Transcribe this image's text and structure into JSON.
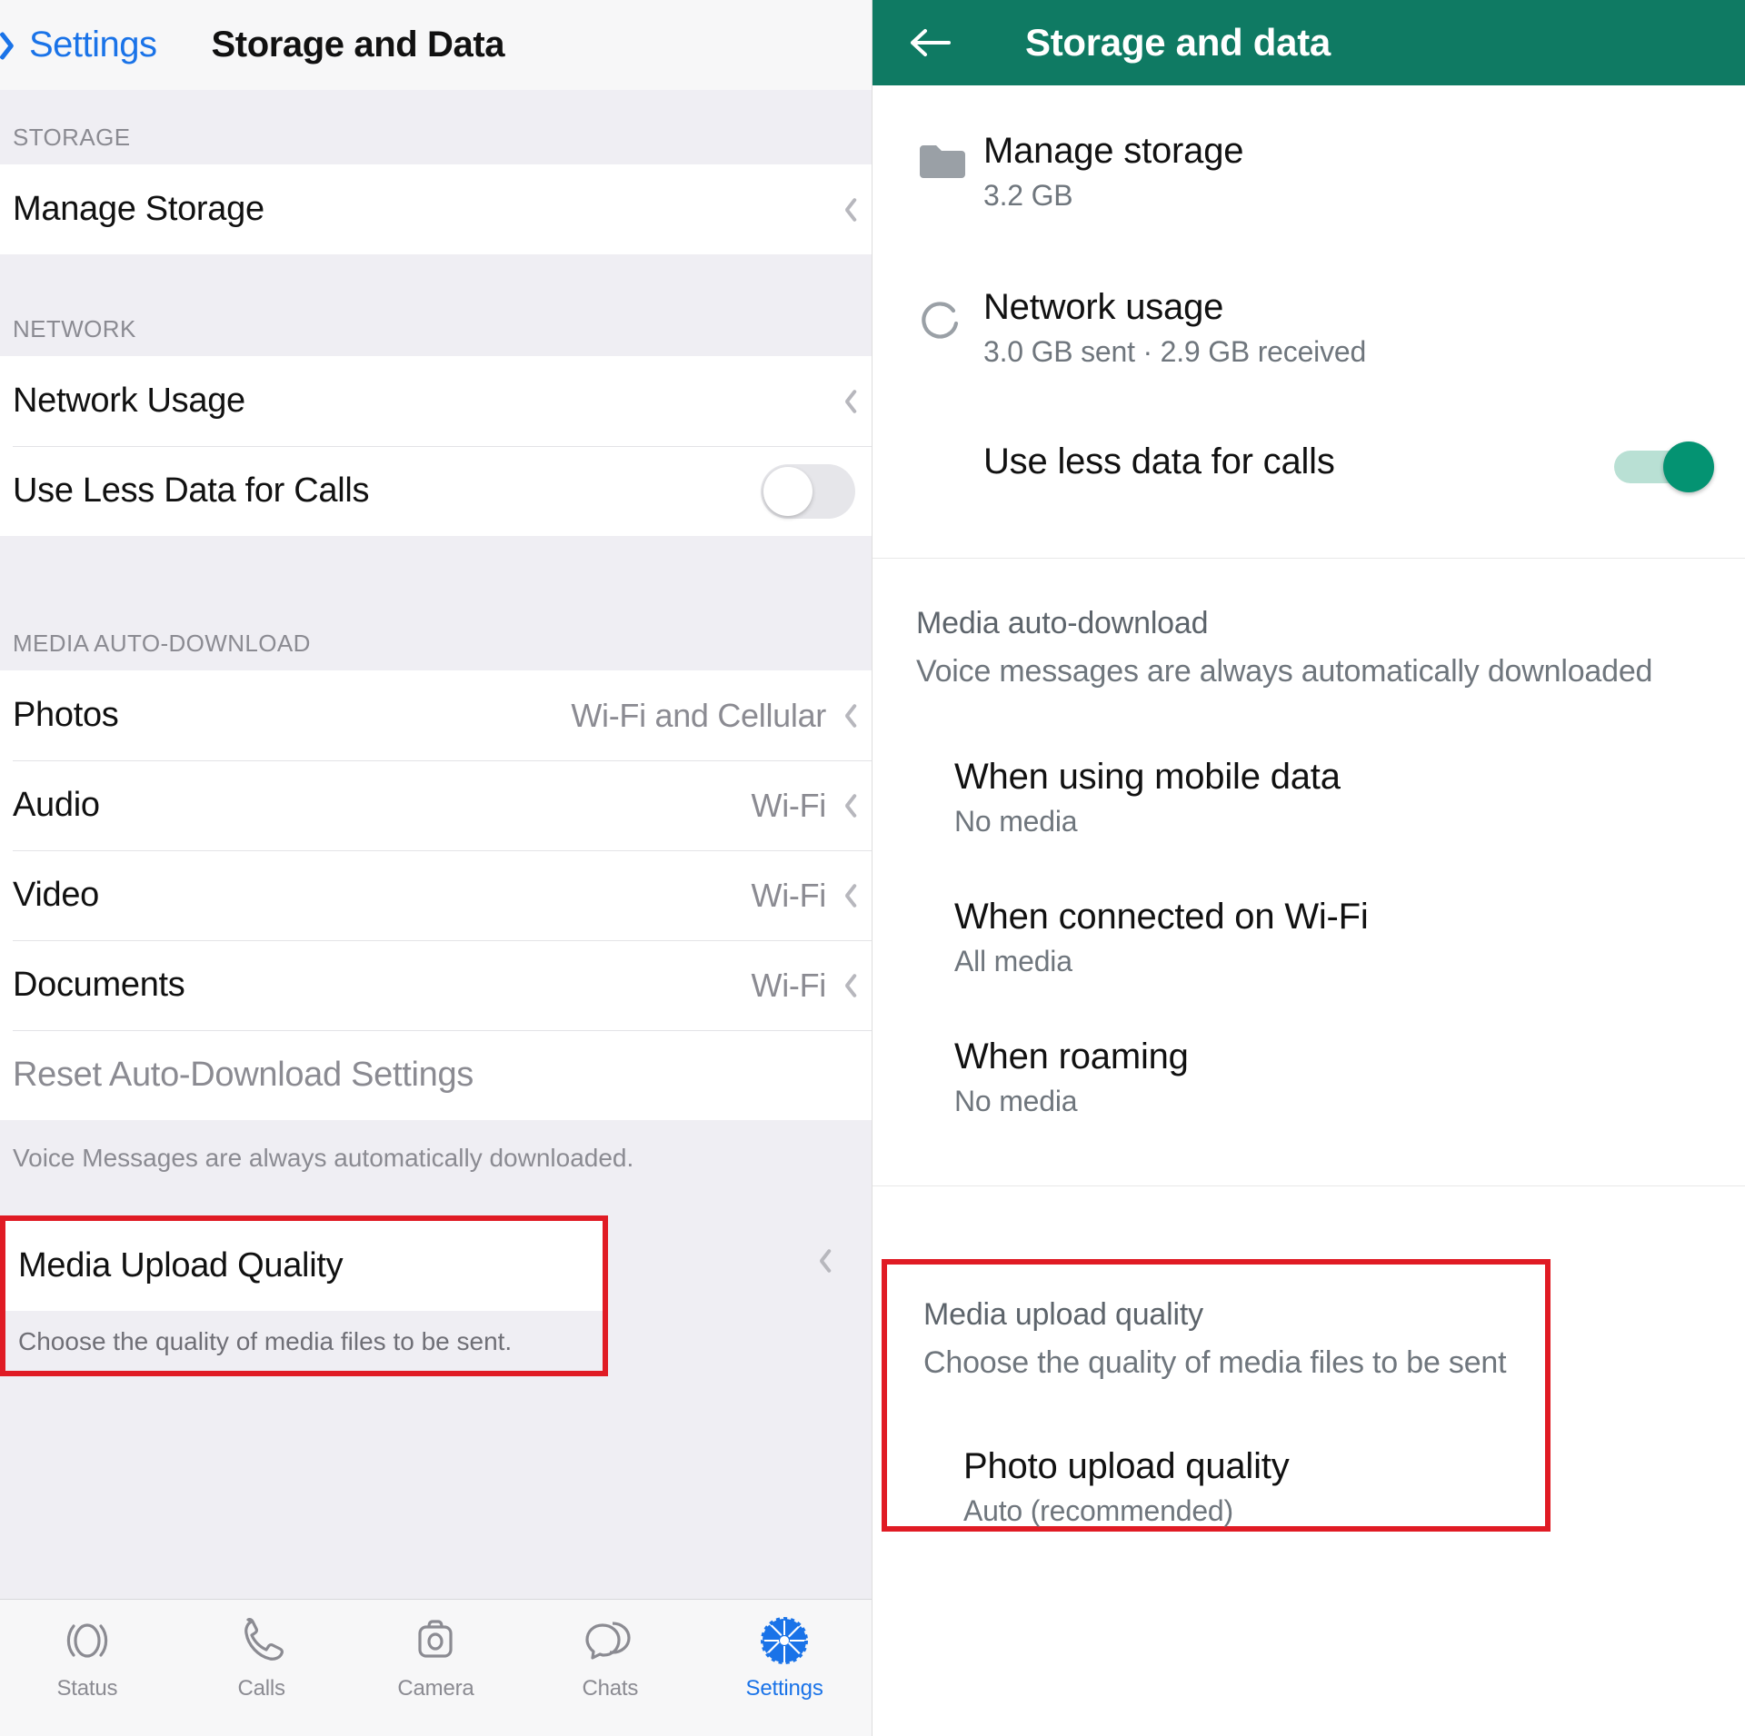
{
  "colors": {
    "ios_accent": "#1a73e8",
    "android_appbar": "#0f7a63",
    "android_toggle_on": "#049372",
    "highlight_border": "#e01b24",
    "ios_group_bg": "#efeef3"
  },
  "ios": {
    "navbar": {
      "back_label": "Settings",
      "title": "Storage and Data",
      "back_icon": "chevron-left-icon"
    },
    "sections": [
      {
        "header": "STORAGE",
        "rows": [
          {
            "label": "Manage Storage",
            "value": "",
            "accessory": "chevron"
          }
        ]
      },
      {
        "header": "NETWORK",
        "rows": [
          {
            "label": "Network Usage",
            "value": "",
            "accessory": "chevron"
          },
          {
            "label": "Use Less Data for Calls",
            "value": "",
            "accessory": "toggle",
            "toggle_on": false
          }
        ]
      },
      {
        "header": "MEDIA AUTO-DOWNLOAD",
        "rows": [
          {
            "label": "Photos",
            "value": "Wi-Fi and Cellular",
            "accessory": "chevron"
          },
          {
            "label": "Audio",
            "value": "Wi-Fi",
            "accessory": "chevron"
          },
          {
            "label": "Video",
            "value": "Wi-Fi",
            "accessory": "chevron"
          },
          {
            "label": "Documents",
            "value": "Wi-Fi",
            "accessory": "chevron"
          },
          {
            "label": "Reset Auto-Download Settings",
            "value": "",
            "accessory": "none",
            "muted": true
          }
        ]
      }
    ],
    "footnote": "Voice Messages are always automatically downloaded.",
    "media_upload_quality": {
      "label": "Media Upload Quality",
      "description": "Choose the quality of media files to be sent.",
      "accessory": "chevron",
      "highlighted": true
    },
    "tabbar": [
      {
        "label": "Status",
        "icon": "status-ring-icon",
        "active": false
      },
      {
        "label": "Calls",
        "icon": "phone-icon",
        "active": false
      },
      {
        "label": "Camera",
        "icon": "camera-icon",
        "active": false
      },
      {
        "label": "Chats",
        "icon": "chat-bubbles-icon",
        "active": false
      },
      {
        "label": "Settings",
        "icon": "gear-icon",
        "active": true
      }
    ]
  },
  "android": {
    "appbar": {
      "title": "Storage and data",
      "back_icon": "arrow-left-icon"
    },
    "rows": [
      {
        "title": "Manage storage",
        "subtitle": "3.2 GB",
        "icon": "folder-icon"
      },
      {
        "title": "Network usage",
        "subtitle": "3.0 GB sent · 2.9 GB received",
        "icon": "refresh-circle-icon"
      }
    ],
    "use_less_data": {
      "title": "Use less data for calls",
      "toggle_on": true
    },
    "media_auto_download": {
      "title": "Media auto-download",
      "subtitle": "Voice messages are always automatically downloaded",
      "items": [
        {
          "title": "When using mobile data",
          "value": "No media"
        },
        {
          "title": "When connected on Wi-Fi",
          "value": "All media"
        },
        {
          "title": "When roaming",
          "value": "No media"
        }
      ]
    },
    "media_upload_quality": {
      "title": "Media upload quality",
      "subtitle": "Choose the quality of media files to be sent",
      "highlighted": true,
      "items": [
        {
          "title": "Photo upload quality",
          "value": "Auto (recommended)"
        }
      ]
    }
  }
}
